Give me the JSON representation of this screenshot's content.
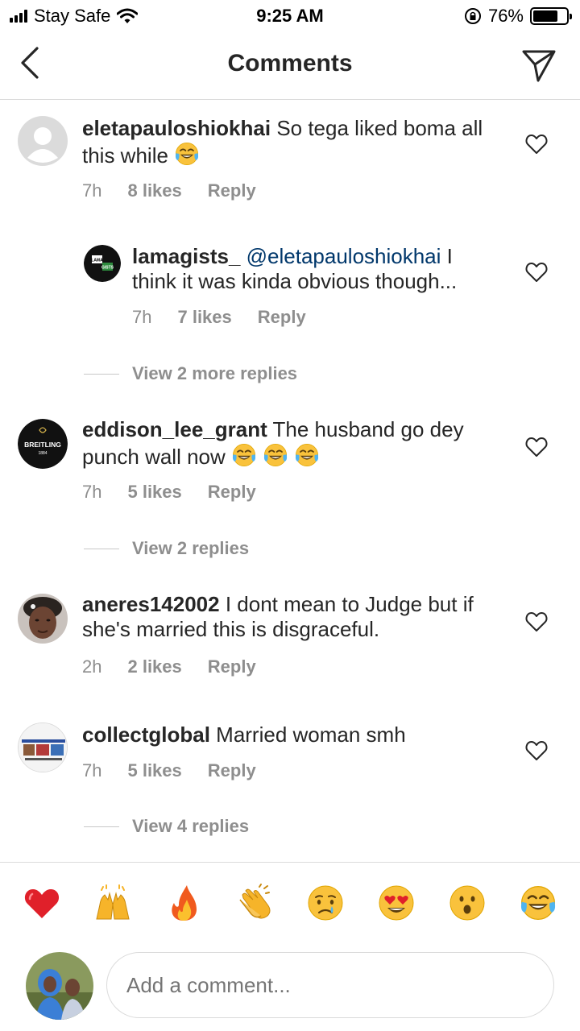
{
  "status": {
    "carrier": "Stay Safe",
    "time": "9:25 AM",
    "battery": "76%",
    "battery_level": 0.76
  },
  "header": {
    "title": "Comments"
  },
  "comments": [
    {
      "username": "eletapauloshiokhai",
      "text": "So tega liked boma all this while",
      "time": "7h",
      "likes": "8 likes",
      "reply": "Reply"
    },
    {
      "username": "lamagists_",
      "mention": "@eletapauloshiokhai",
      "text": "I think it was kinda obvious though...",
      "time": "7h",
      "likes": "7 likes",
      "reply": "Reply",
      "avatar_text_top": "LAMA",
      "avatar_text_bottom": "GISTS"
    },
    {
      "username": "eddison_lee_grant",
      "text": "The husband go dey punch wall now",
      "time": "7h",
      "likes": "5 likes",
      "reply": "Reply",
      "avatar_brand": "BREITLING",
      "avatar_year": "1884"
    },
    {
      "username": "aneres142002",
      "text": "I dont mean to Judge but if she's married this is disgraceful.",
      "time": "2h",
      "likes": "2 likes",
      "reply": "Reply"
    },
    {
      "username": "collectglobal",
      "text": "Married woman smh",
      "time": "7h",
      "likes": "5 likes",
      "reply": "Reply"
    }
  ],
  "view_replies": [
    "View 2 more replies",
    "View 2 replies",
    "View 4 replies"
  ],
  "reactions": [
    "red-heart",
    "raising-hands",
    "fire",
    "clapping-hands",
    "crying-face",
    "heart-eyes-face",
    "astonished-face",
    "tears-of-joy-face"
  ],
  "composer": {
    "placeholder": "Add a comment..."
  },
  "colors": {
    "text": "#262626",
    "secondary": "#8e8e8e",
    "mention": "#00376b",
    "divider": "#dbdbdb"
  }
}
